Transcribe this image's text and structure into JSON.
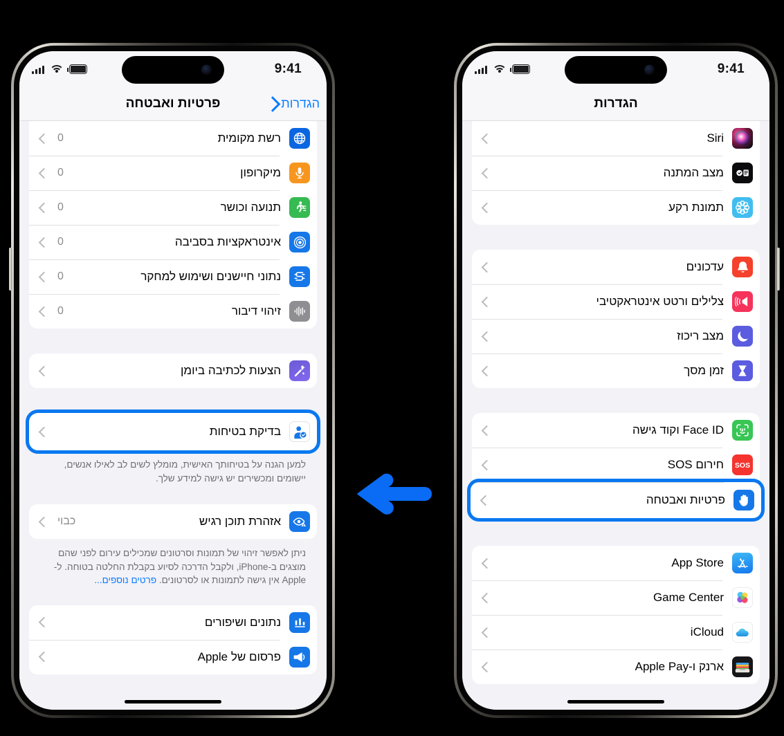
{
  "meta": {
    "accent_blue": "#0a7cff",
    "highlight_blue": "#0a78f0",
    "background": "#000000",
    "screen_bg": "#f2f2f7"
  },
  "arrow": {
    "name": "left-pointing-arrow",
    "direction": "left",
    "color": "#0a6cf5"
  },
  "left_phone": {
    "status_bar": {
      "time": "9:41",
      "battery_icon": "battery-icon",
      "wifi_icon": "wifi-icon",
      "cellular_icon": "cellular-bars-icon"
    },
    "nav": {
      "title": "פרטיות ואבטחה",
      "back_label": "הגדרות",
      "back_icon": "chevron-right-icon"
    },
    "groups": [
      {
        "id": "permissions",
        "rows": [
          {
            "label": "רשת מקומית",
            "value": "0",
            "icon": "local-network-globe-icon"
          },
          {
            "label": "מיקרופון",
            "value": "0",
            "icon": "microphone-icon"
          },
          {
            "label": "תנועה וכושר",
            "value": "0",
            "icon": "motion-fitness-icon"
          },
          {
            "label": "אינטראקציות בסביבה",
            "value": "0",
            "icon": "nearby-interactions-icon"
          },
          {
            "label": "נתוני חיישנים ושימוש למחקר",
            "value": "0",
            "icon": "sensor-research-icon"
          },
          {
            "label": "זיהוי דיבור",
            "value": "0",
            "icon": "speech-recognition-icon"
          }
        ]
      },
      {
        "id": "writing-suggestions",
        "rows": [
          {
            "label": "הצעות לכתיבה ביומן",
            "value": "",
            "icon": "journaling-suggestions-icon"
          }
        ]
      },
      {
        "id": "safety-check",
        "highlighted": true,
        "rows": [
          {
            "label": "בדיקת בטיחות",
            "value": "",
            "icon": "safety-check-person-icon"
          }
        ],
        "footnote": "למען הגנה על בטיחותך האישית, מומלץ לשים לב לאילו אנשים, יישומים ומכשירים יש גישה למידע שלך."
      },
      {
        "id": "sensitive-content",
        "rows": [
          {
            "label": "אזהרת תוכן רגיש",
            "value": "כבוי",
            "icon": "sensitive-content-eye-icon"
          }
        ],
        "footnote": "ניתן לאפשר זיהוי של תמונות וסרטונים שמכילים עירום לפני שהם מוצגים ב-iPhone, ולקבל הדרכה לסיוע בקבלת החלטה בטוחה. ל-Apple אין גישה לתמונות או לסרטונים.",
        "footnote_link": "פרטים נוספים..."
      },
      {
        "id": "analytics",
        "rows": [
          {
            "label": "נתונים ושיפורים",
            "value": "",
            "icon": "analytics-chart-icon"
          },
          {
            "label": "פרסום של Apple",
            "value": "",
            "icon": "apple-advertising-icon"
          }
        ]
      }
    ]
  },
  "right_phone": {
    "status_bar": {
      "time": "9:41",
      "battery_icon": "battery-icon",
      "wifi_icon": "wifi-icon",
      "cellular_icon": "cellular-bars-icon"
    },
    "nav": {
      "title": "הגדרות",
      "back_label": "",
      "back_icon": ""
    },
    "groups": [
      {
        "id": "siri-group",
        "rows": [
          {
            "label": "Siri",
            "value": "",
            "icon": "siri-icon"
          },
          {
            "label": "מצב המתנה",
            "value": "",
            "icon": "standby-icon"
          },
          {
            "label": "תמונת רקע",
            "value": "",
            "icon": "wallpaper-icon"
          }
        ]
      },
      {
        "id": "notifications-group",
        "rows": [
          {
            "label": "עדכונים",
            "value": "",
            "icon": "notifications-bell-icon"
          },
          {
            "label": "צלילים ורטט אינטראקטיבי",
            "value": "",
            "icon": "sounds-haptics-icon"
          },
          {
            "label": "מצב ריכוז",
            "value": "",
            "icon": "focus-moon-icon"
          },
          {
            "label": "זמן מסך",
            "value": "",
            "icon": "screen-time-hourglass-icon"
          }
        ]
      },
      {
        "id": "security-group",
        "rows": [
          {
            "label": "Face ID וקוד גישה",
            "value": "",
            "icon": "face-id-icon"
          },
          {
            "label": "חירום SOS",
            "value": "",
            "icon": "emergency-sos-icon"
          },
          {
            "label": "פרטיות ואבטחה",
            "value": "",
            "icon": "privacy-hand-icon",
            "highlighted": true
          }
        ]
      },
      {
        "id": "accounts-group",
        "rows": [
          {
            "label": "App Store",
            "value": "",
            "icon": "app-store-icon"
          },
          {
            "label": "Game Center",
            "value": "",
            "icon": "game-center-icon"
          },
          {
            "label": "iCloud",
            "value": "",
            "icon": "icloud-icon"
          },
          {
            "label": "ארנק ו-Apple Pay",
            "value": "",
            "icon": "wallet-apple-pay-icon"
          }
        ]
      }
    ]
  }
}
